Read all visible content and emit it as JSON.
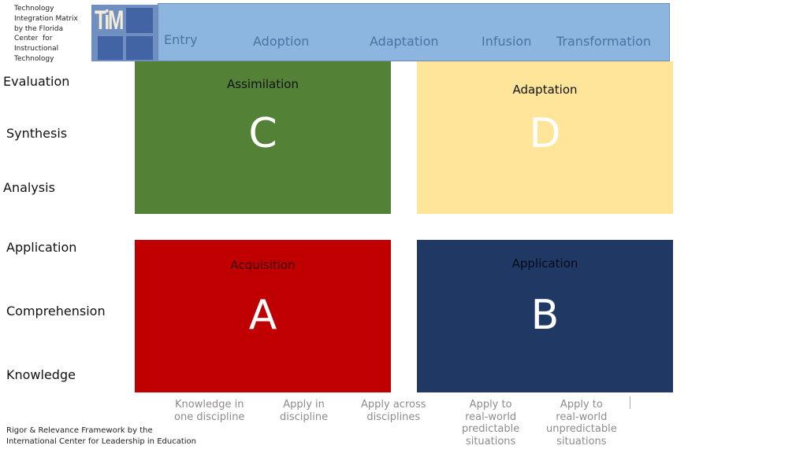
{
  "credits": {
    "tim_source": "Technology Integration Matrix by the Florida Center for Instructional Technology",
    "tim_source_lines": [
      "Technology",
      "Integration Matrix",
      "by the Florida",
      "Center  for",
      "Instructional",
      "Technology"
    ],
    "logo_text": "TiM",
    "rr_source_lines": [
      "Rigor & Relevance Framework by the",
      "International Center for Leadership in Education"
    ]
  },
  "tim_levels": [
    "Entry",
    "Adoption",
    "Adaptation",
    "Infusion",
    "Transformation"
  ],
  "bloom_levels": [
    "Evaluation",
    "Synthesis",
    "Analysis",
    "Application",
    "Comprehension",
    "Knowledge"
  ],
  "quadrants": {
    "C": {
      "title": "Assimilation",
      "letter": "C",
      "color": "#538135"
    },
    "D": {
      "title": "Adaptation",
      "letter": "D",
      "color": "#ffe599"
    },
    "A": {
      "title": "Acquisition",
      "letter": "A",
      "color": "#c00000"
    },
    "B": {
      "title": "Application",
      "letter": "B",
      "color": "#1f3864"
    }
  },
  "application_levels": [
    [
      "Knowledge in",
      "one discipline"
    ],
    [
      "Apply in",
      "discipline"
    ],
    [
      "Apply across",
      "disciplines"
    ],
    [
      "Apply to",
      "real-world",
      "predictable",
      "situations"
    ],
    [
      "Apply to",
      "real-world",
      "unpredictable",
      "situations"
    ]
  ],
  "colors": {
    "tim_bar": "#8cb6e0",
    "tim_text": "#4d72a0",
    "relevance_text": "#8c8c8c"
  }
}
